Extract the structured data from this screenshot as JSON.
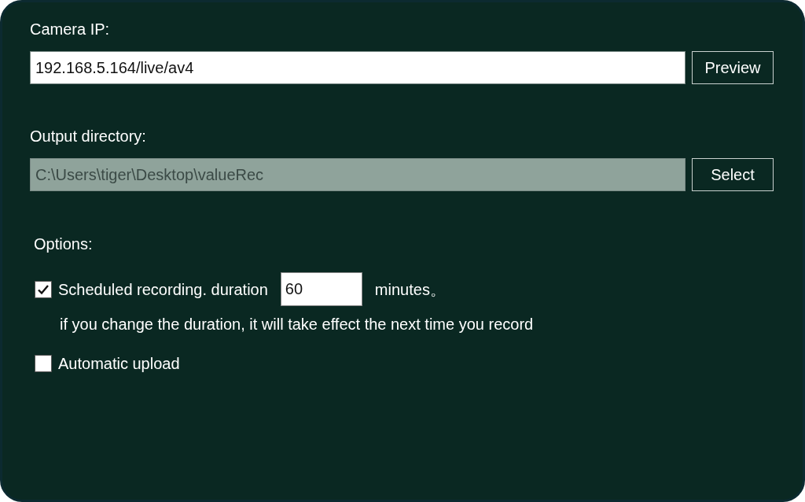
{
  "camera_ip": {
    "label": "Camera IP:",
    "value": "192.168.5.164/live/av4",
    "disabled": false,
    "button": "Preview"
  },
  "output_directory": {
    "label": "Output directory:",
    "value": "C:\\Users\\tiger\\Desktop\\valueRec",
    "disabled": true,
    "button": "Select"
  },
  "options": {
    "label": "Options:",
    "items": [
      {
        "kind": "duration",
        "label": "Scheduled recording. duration",
        "checked": true,
        "value": "60",
        "unit": "minutes。",
        "hint": "if you change the duration, it will take effect the next time you record"
      },
      {
        "kind": "plain",
        "label": "Automatic upload",
        "checked": false
      }
    ]
  }
}
